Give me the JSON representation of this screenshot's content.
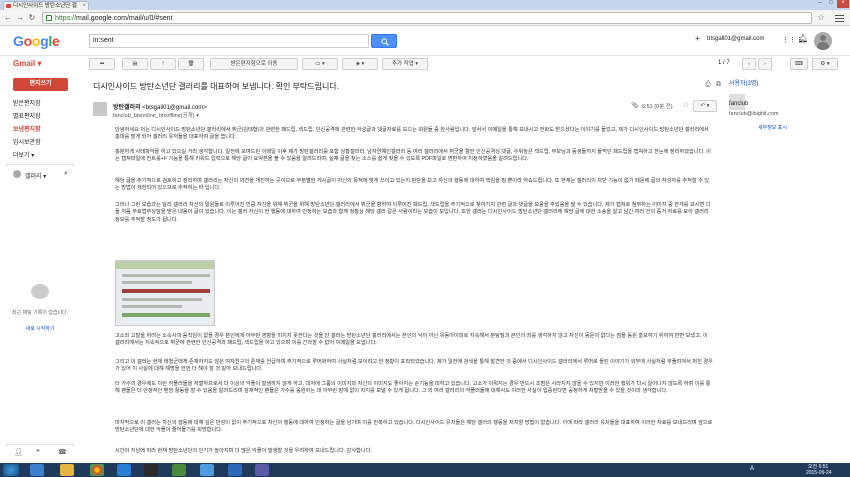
{
  "browser": {
    "tab_title": "디시인사이드 방탄소년단 갤",
    "url_prefix": "https://",
    "url_rest": "mail.google.com/mail/u/0/#sent"
  },
  "header": {
    "logo": "Google",
    "search_value": "in:sent",
    "user_email": "btsgall01@gmail.com",
    "plus": "+"
  },
  "toolbar": {
    "app_label": "Gmail",
    "move_label": "받은편지함으로 이동",
    "more_label": "추가 작업",
    "paging": "1 / 7"
  },
  "sidebar": {
    "compose": "편지쓰기",
    "items": [
      {
        "label": "받은편지함"
      },
      {
        "label": "별표편지함"
      },
      {
        "label": "보낸편지함"
      },
      {
        "label": "임시보관함"
      },
      {
        "label": "더보기 ▾"
      }
    ],
    "hangout_user": "갤러리",
    "no_chat": "최근 채팅 기록이 없습니다.",
    "new_chat": "새로 시작하기"
  },
  "message": {
    "subject": "디시인사이드 방탄소년단 갤러리를 대표하여 보냅니다. 확인 부탁드립니다.",
    "sender_name": "방탄갤러리",
    "sender_email": "<btsgall01@gmail.com>",
    "to": "fanclub_btsonline_btsoffline(공개) ▾",
    "date": "6:51 (0분 전)",
    "paragraphs": [
      "안녕하세요 저는 디시인사이드 방탄소년단 갤러리에서 뷔군(김태형)과 관련한 패드립, 섹드립, 인신공격에 관련한 악성글과 댓글자료를 모으는 회원들 중 한사람입니다. 앞서서 이메일을 통해 보내시고 전화도 받으셨다는 이야기를 들었고, 제가 디시인사이드 방탄소년단 갤러리에서 총대를 맡게 되어 갤러리 유저들을 대표하여 글을 씁니다.",
      "충분하게 사태파악을 하고 있으실 거라 생각합니다. 일전에 보여드린 이메일 이후 제가 방탄갤러리를 포함 상황갤러리, 남자연예인갤러리 등 여러 갤러리에서 뷔군을 향한 인신공격성 댓글, 수위높은 섹드립, 부모님과 동생들까지 들먹인 패드립을 캡쳐하고 한눈에 정리하였습니다. 이는 캡쳐파일에 컨트롤+F 기능을 통해 키워드 입력으로 해당 글이 요약본을 볼 수 있음을 알려드리며, 실제 글을 찾는 소스를 쉽게 찾을 수 있도록 PDF파일로 변환하여 지정하였음을 알려드립니다.",
      "해당 글을 주기적으로 검토하고 정리하며 갤러리는 자신의 의견을 개진하는 곳이므로 무분별한 게시글이 자신의 목적에 맞게 쓰이고 있는지 판단을 보고 자신의 행동에 대하여 책임을 질 뿐이라 약속드립니다. 또 현재는 갤러리의 차단 기능이 없기 때문에 글의 작성자를 추적할 수 있는 방법이 제한되어 있으므로 추적하는 바 입니다.",
      "그러나 그런 모습과는 달리 갤러리 자신의 일원들로 이루어진 만큼 자신을 위해 뷔군을 위해 방탄소년단 갤러리에서 뷔군을 향하여 이루어진 패드립, 섹드립을 주기적으로 찾아가지 관련 글과 댓글을 모음을 주었음을 말 수 있습니다. 제가 캡쳐로 첨부하는 이미지 중 한개를 보시면 다들 처음 무료법무상담을 받은 내용이 글이 있습니다. 이는 갤러 자신이 한 행동에 대하여 인정하는 모습과 함께 정황상 해당 갤러 갈은 사람이라는 모습이 보입니다. 또한 갤러는 디시인사이드 방탄소년단 갤러리에 해당 글에 대한 소송을 알고 남긴 여러 건의 증거 자료를 모아 갤러리 정보를 추적할 정도가 됩니다.",
      "고소와 고발을 하려는 소속사의 움직임이 없을 경우 본인에게 아무런 영향을 미치지 못한다는 것을 안 갤러는 방탄소년단 갤러리에서는 본인의 닉이 아닌 유동아이피로 지속해서 분탕질과 본인의 죄를 생각하지 않고 자신이 동문이 없다는 점을 동원 홍보하기 위하여 반면 보냈고, 이 갤러리에서는 지속적으로 뷔군에 관련한 인신공격과 패드립, 섹드립을 하고 있으며 이를 간과할 수 없어 이메일을 보냅니다.",
      "그리고 이 갤러는 현재 태형군에게 존재하지도 않은 여자친구의 존재를 언급하며 주기적으로 루머화하여 사실처럼 보이려고 한 정황이 포착되었습니다. 제가 일전에 검색을 통해 발견한 것 중에서 디시인사이드 갤러리에서 루머로 올린 이야기가 외부에 사실처럼 부풀려져서 퍼진 경우가 있어 이 사실에 대해 해명을 한번 더 해야 할 것 같아 보내드립니다.",
      "타 가수의 경우에도 이런 악플러들을 처벌하므로서 더 이상의 악플이 발생하지 않게 하고, 대처에 그룹의 이미지와 자신의 이미지도 좋아지는 순기능을 띠하고 있습니다. 고소가 이뤄지는 경우 반드시 초범은 사라지지 않을 수 있지만 이러한 행위가 다시 일어나지 않도록 하며 이를 통해 팬들은 더 안정적인 팬덤 활동을 할 수 있음을 알려드리며 잠재적인 팬들은 가수를 응원하는 데 아무런 장애 없이 지지를 보낼 수 있게 됩니다. 그 외 여러 갤러리의 악플러들에 대해서도 이러한 사실이 입증된다면 공정하게 처벌받을 수 있을 것이라 생각합니다.",
      "마지막으로 이 갤러는 자신의 행동에 대해 깊은 반성이 없이 주기적으로 자신의 행동에 대하여 인정하는 글을 남기며 이를 반복하고 있습니다. 디시인사이드 유저들은 해당 갤러의 행동을 저지할 방법이 없습니다. 이에 따라 갤러리 유저들을 대표하여 이러한 자료를 보내드리며 앞으로 방탄소년단에 대한 악플이 줄어들기를 희망합니다.",
      "시간이 지남에 따라 현재 방탄소년단의 인기가 높아지며 더 많은 악플이 발생할 것을 우려하여 보내드립니다. 감사합니다."
    ]
  },
  "right_panel": {
    "people_label": "사용자(3명)",
    "contact_name": "fanclub",
    "contact_email": "fanclub@ibighit.com",
    "more_link": "세부정보 표시"
  },
  "taskbar": {
    "lang": "A",
    "time": "오전 6:51",
    "date": "2015-09-24"
  },
  "colors": {
    "accent": "#d14836",
    "blue": "#4d90fe",
    "taskbar": "#1f3a5a"
  }
}
